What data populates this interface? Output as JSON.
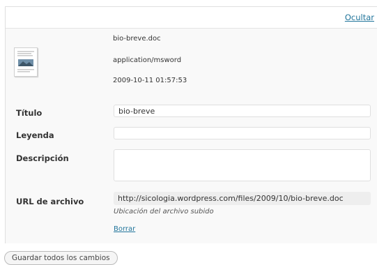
{
  "toggle_link": "Ocultar",
  "file": {
    "name": "bio-breve.doc",
    "mime": "application/msword",
    "date": "2009-10-11 01:57:53",
    "thumbnail_icon": "document-thumbnail-icon"
  },
  "fields": {
    "title": {
      "label": "Título",
      "value": "bio-breve"
    },
    "caption": {
      "label": "Leyenda",
      "value": ""
    },
    "description": {
      "label": "Descripción",
      "value": ""
    },
    "url": {
      "label": "URL de archivo",
      "value": "http://sicologia.wordpress.com/files/2009/10/bio-breve.doc",
      "help": "Ubicación del archivo subido"
    }
  },
  "delete_link": "Borrar",
  "save_button": "Guardar todos los cambios"
}
